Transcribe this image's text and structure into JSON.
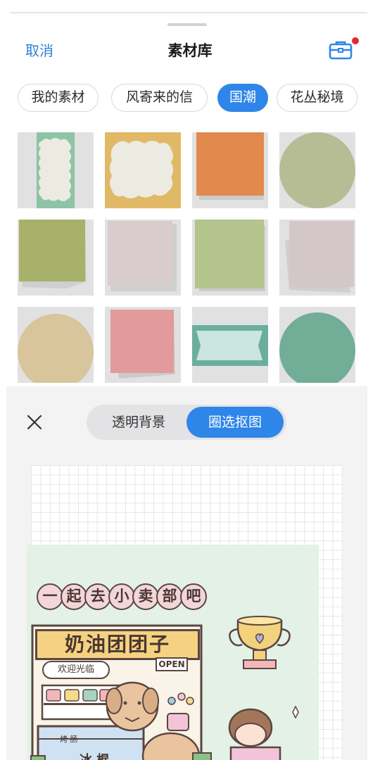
{
  "header": {
    "cancel_label": "取消",
    "title": "素材库",
    "toolbox_icon": "toolbox-icon",
    "notification_color": "#e5262f"
  },
  "tabs": [
    {
      "label": "我的素材",
      "active": false
    },
    {
      "label": "风寄来的信",
      "active": false
    },
    {
      "label": "国潮",
      "active": true
    },
    {
      "label": "花丛秘境",
      "active": false
    }
  ],
  "materials": [
    {
      "name": "tall-cloud-label",
      "colors": [
        "#8fc3a6",
        "#ecebe2"
      ]
    },
    {
      "name": "wide-cloud-label",
      "colors": [
        "#e1b866",
        "#ecebe2"
      ]
    },
    {
      "name": "orange-sticky-note",
      "colors": [
        "#e28a4d"
      ]
    },
    {
      "name": "sage-circle",
      "colors": [
        "#b6bd95"
      ]
    },
    {
      "name": "olive-sticky-note",
      "colors": [
        "#a7b16a"
      ]
    },
    {
      "name": "mauve-square",
      "colors": [
        "#d8cccc"
      ]
    },
    {
      "name": "green-sticky-note",
      "colors": [
        "#b3c48d"
      ]
    },
    {
      "name": "grey-pink-sticky-note",
      "colors": [
        "#d3c7c7"
      ]
    },
    {
      "name": "beige-circle",
      "colors": [
        "#d8c59c"
      ]
    },
    {
      "name": "pink-sticky-note",
      "colors": [
        "#e39a9a"
      ]
    },
    {
      "name": "mint-ticket",
      "colors": [
        "#6cae9c",
        "#cbe5df"
      ]
    },
    {
      "name": "teal-circle",
      "colors": [
        "#72ad98"
      ]
    }
  ],
  "editor": {
    "close_icon": "close-icon",
    "mode_transparent": "透明背景",
    "mode_lasso": "圈选抠图",
    "active_mode": "圈选抠图",
    "accent_color": "#2e86e8"
  },
  "sticker": {
    "bubble_chars": [
      "一",
      "起",
      "去",
      "小",
      "卖",
      "部",
      "吧"
    ],
    "shop_name": "奶油团团子",
    "welcome": "欢迎光临",
    "open_sign": "OPEN",
    "shelf_label": "烤 肠",
    "counter_text": "冰 棍"
  }
}
